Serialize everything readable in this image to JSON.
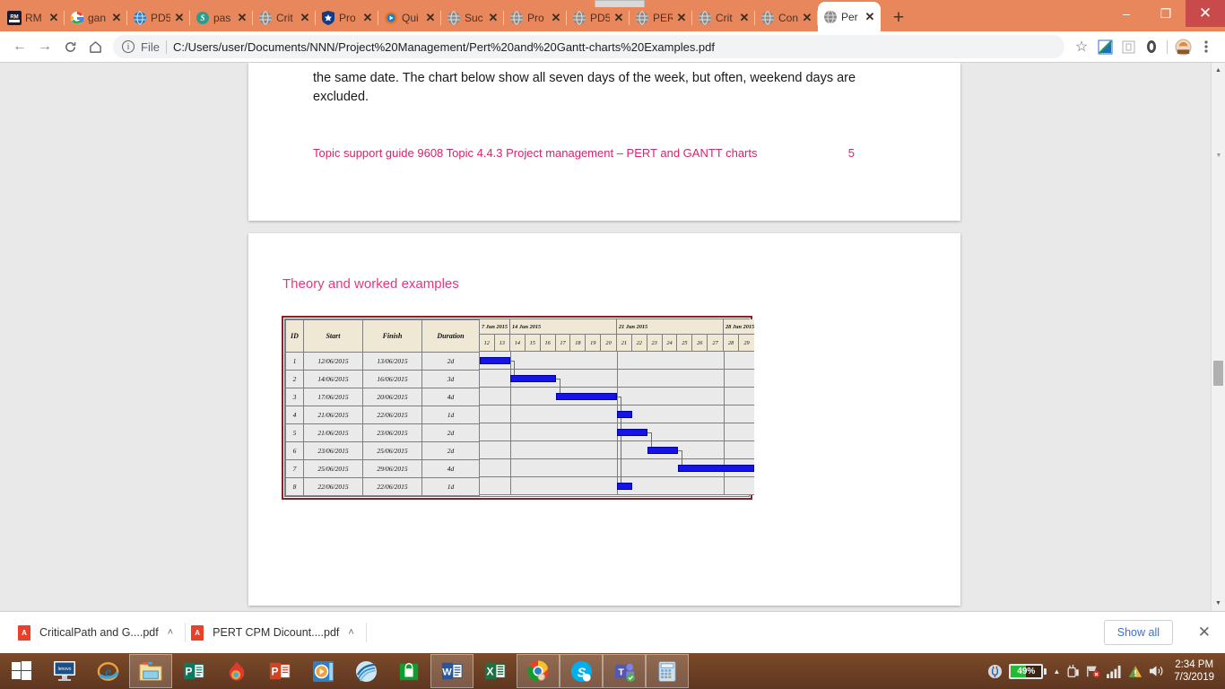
{
  "browser": {
    "tabs": [
      {
        "label": "RM",
        "icon": "rm-logo-icon",
        "active": false
      },
      {
        "label": "gan",
        "icon": "google-icon",
        "active": false
      },
      {
        "label": "PD5",
        "icon": "globe-blue-icon",
        "active": false
      },
      {
        "label": "pas",
        "icon": "globe-green-icon",
        "active": false
      },
      {
        "label": "Crit",
        "icon": "globe-gray-icon",
        "active": false
      },
      {
        "label": "Pro",
        "icon": "shield-star-icon",
        "active": false
      },
      {
        "label": "Qui",
        "icon": "play-circle-icon",
        "active": false
      },
      {
        "label": "Suc",
        "icon": "globe-gray-icon",
        "active": false
      },
      {
        "label": "Pro",
        "icon": "globe-gray-icon",
        "active": false
      },
      {
        "label": "PD5",
        "icon": "globe-gray-icon",
        "active": false
      },
      {
        "label": "PER",
        "icon": "globe-gray-icon",
        "active": false
      },
      {
        "label": "Crit",
        "icon": "globe-gray-icon",
        "active": false
      },
      {
        "label": "Con",
        "icon": "globe-gray-icon",
        "active": false
      },
      {
        "label": "Per",
        "icon": "globe-gray-icon",
        "active": true
      }
    ],
    "tab_close_glyph": "✕",
    "new_tab_label": "+",
    "window_controls": {
      "minimize": "–",
      "maximize": "❐",
      "close": "✕"
    },
    "nav": {
      "back": "←",
      "forward": "→",
      "reload": "⟳",
      "home": "home-icon"
    },
    "omnibox": {
      "info_glyph": "i",
      "scheme_label": "File",
      "url": "C:/Users/user/Documents/NNN/Project%20Management/Pert%20and%20Gantt-charts%20Examples.pdf",
      "bookmark_glyph": "☆"
    },
    "toolbar_icons": [
      "extension-blue-icon",
      "extension-gray-icon",
      "extension-oval-icon",
      "profile-avatar-icon",
      "menu-kebab-icon"
    ]
  },
  "document": {
    "page1": {
      "body_text": "the same date. The chart below show all seven days of the week, but often, weekend days are excluded.",
      "footer_text": "Topic support guide 9608 Topic 4.4.3 Project management – PERT and GANTT charts",
      "footer_page": "5"
    },
    "page2": {
      "section_title": "Theory and worked examples"
    }
  },
  "chart_data": {
    "type": "table",
    "title": "Gantt chart",
    "columns": [
      "ID",
      "Start",
      "Finish",
      "Duration"
    ],
    "week_headers": [
      {
        "label": "7 Jun 2015",
        "days": [
          "12",
          "13"
        ]
      },
      {
        "label": "14 Jun 2015",
        "days": [
          "14",
          "15",
          "16",
          "17",
          "18",
          "19",
          "20"
        ]
      },
      {
        "label": "21 Jun 2015",
        "days": [
          "21",
          "22",
          "23",
          "24",
          "25",
          "26",
          "27"
        ]
      },
      {
        "label": "28 Jun 2015",
        "days": [
          "28",
          "29"
        ]
      }
    ],
    "day_axis": [
      "12",
      "13",
      "14",
      "15",
      "16",
      "17",
      "18",
      "19",
      "20",
      "21",
      "22",
      "23",
      "24",
      "25",
      "26",
      "27",
      "28",
      "29"
    ],
    "rows": [
      {
        "id": "1",
        "start": "12/06/2015",
        "finish": "13/06/2015",
        "duration": "2d",
        "bar_start_day": 12,
        "bar_end_day": 13
      },
      {
        "id": "2",
        "start": "14/06/2015",
        "finish": "16/06/2015",
        "duration": "3d",
        "bar_start_day": 14,
        "bar_end_day": 16
      },
      {
        "id": "3",
        "start": "17/06/2015",
        "finish": "20/06/2015",
        "duration": "4d",
        "bar_start_day": 17,
        "bar_end_day": 20
      },
      {
        "id": "4",
        "start": "21/06/2015",
        "finish": "22/06/2015",
        "duration": "1d",
        "bar_start_day": 21,
        "bar_end_day": 21
      },
      {
        "id": "5",
        "start": "21/06/2015",
        "finish": "23/06/2015",
        "duration": "2d",
        "bar_start_day": 21,
        "bar_end_day": 22
      },
      {
        "id": "6",
        "start": "23/06/2015",
        "finish": "25/06/2015",
        "duration": "2d",
        "bar_start_day": 23,
        "bar_end_day": 24
      },
      {
        "id": "7",
        "start": "25/06/2015",
        "finish": "29/06/2015",
        "duration": "4d",
        "bar_start_day": 25,
        "bar_end_day": 29
      },
      {
        "id": "8",
        "start": "22/06/2015",
        "finish": "22/06/2015",
        "duration": "1d",
        "bar_start_day": 21,
        "bar_end_day": 21
      }
    ],
    "bar_color": "#1414e6",
    "frame_color": "#8d2024"
  },
  "download_shelf": {
    "items": [
      {
        "label": "CriticalPath and G....pdf",
        "caret": "˄"
      },
      {
        "label": "PERT CPM Dicount....pdf",
        "caret": "˄"
      }
    ],
    "show_all_label": "Show all",
    "close_glyph": "✕"
  },
  "taskbar": {
    "start_label": "start-icon",
    "apps": [
      "lenovo-icon",
      "internet-explorer-icon",
      "file-explorer-icon",
      "publisher-icon",
      "flame-icon",
      "powerpoint-icon",
      "media-player-icon",
      "wave-icon",
      "store-icon",
      "word-icon",
      "excel-icon",
      "chrome-icon",
      "skype-icon",
      "teams-icon",
      "calculator-icon"
    ],
    "open_apps": [
      "file-explorer-icon",
      "word-icon",
      "chrome-icon",
      "skype-icon",
      "teams-icon",
      "calculator-icon"
    ],
    "tray": {
      "battery_percent": "49%",
      "battery_level": 49,
      "show_hidden_glyph": "▲",
      "icons": [
        "usb-icon",
        "network-error-icon",
        "signal-icon",
        "warning-icon",
        "volume-icon"
      ],
      "time": "2:34 PM",
      "date": "7/3/2019"
    }
  }
}
